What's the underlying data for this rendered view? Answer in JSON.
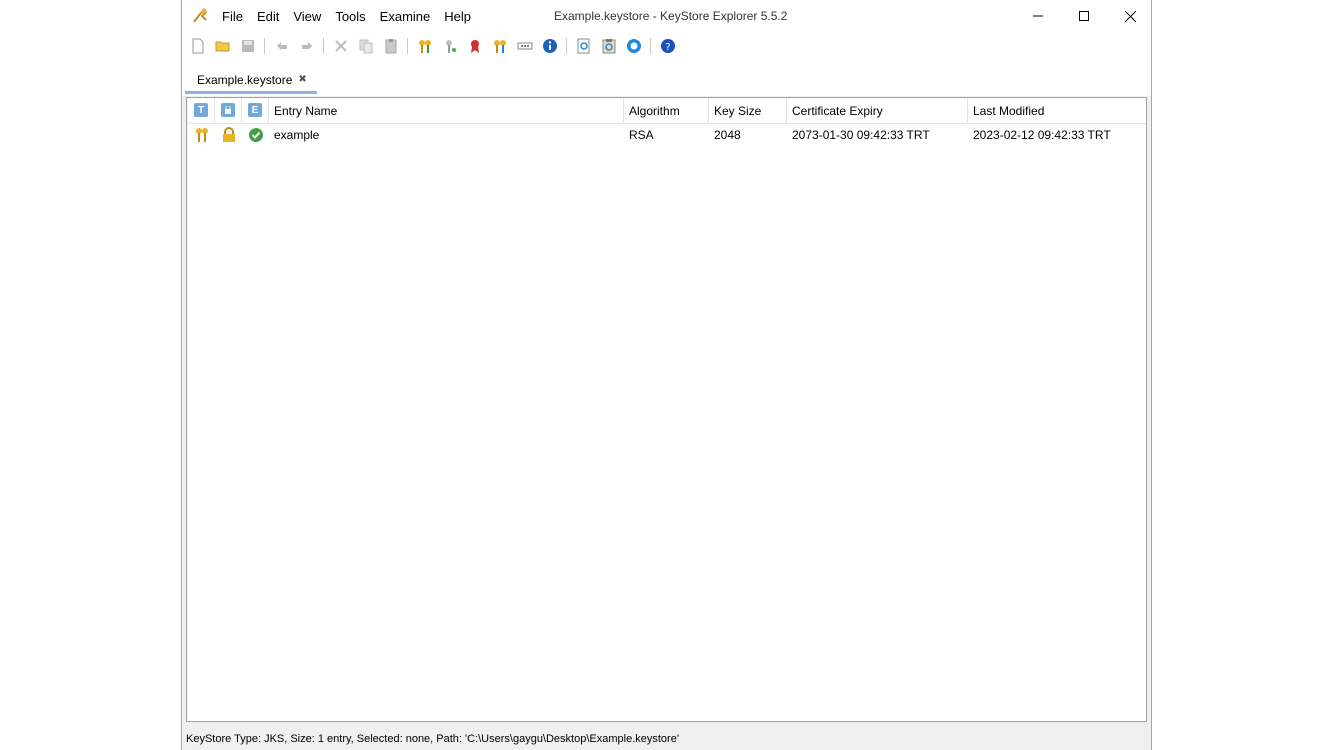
{
  "window": {
    "title": "Example.keystore - KeyStore Explorer 5.5.2"
  },
  "menu": [
    "File",
    "Edit",
    "View",
    "Tools",
    "Examine",
    "Help"
  ],
  "toolbar": {
    "icons": [
      "new-icon",
      "open-icon",
      "save-icon",
      "undo-icon",
      "redo-icon",
      "cut-icon",
      "copy-icon",
      "paste-icon",
      "generate-key-pair-icon",
      "generate-secret-key-icon",
      "import-trusted-cert-icon",
      "import-key-pair-icon",
      "set-password-icon",
      "keystore-properties-icon",
      "examine-file-icon",
      "examine-clipboard-icon",
      "examine-ssl-icon",
      "help-icon"
    ]
  },
  "tab": {
    "label": "Example.keystore",
    "close": "✖"
  },
  "table": {
    "headers": [
      "T",
      "",
      "E",
      "Entry Name",
      "Algorithm",
      "Key Size",
      "Certificate Expiry",
      "Last Modified"
    ],
    "rows": [
      {
        "entry_name": "example",
        "algorithm": "RSA",
        "key_size": "2048",
        "expiry": "2073-01-30 09:42:33 TRT",
        "modified": "2023-02-12 09:42:33 TRT"
      }
    ]
  },
  "status": "KeyStore Type: JKS, Size: 1 entry, Selected: none, Path: 'C:\\Users\\gaygu\\Desktop\\Example.keystore'"
}
